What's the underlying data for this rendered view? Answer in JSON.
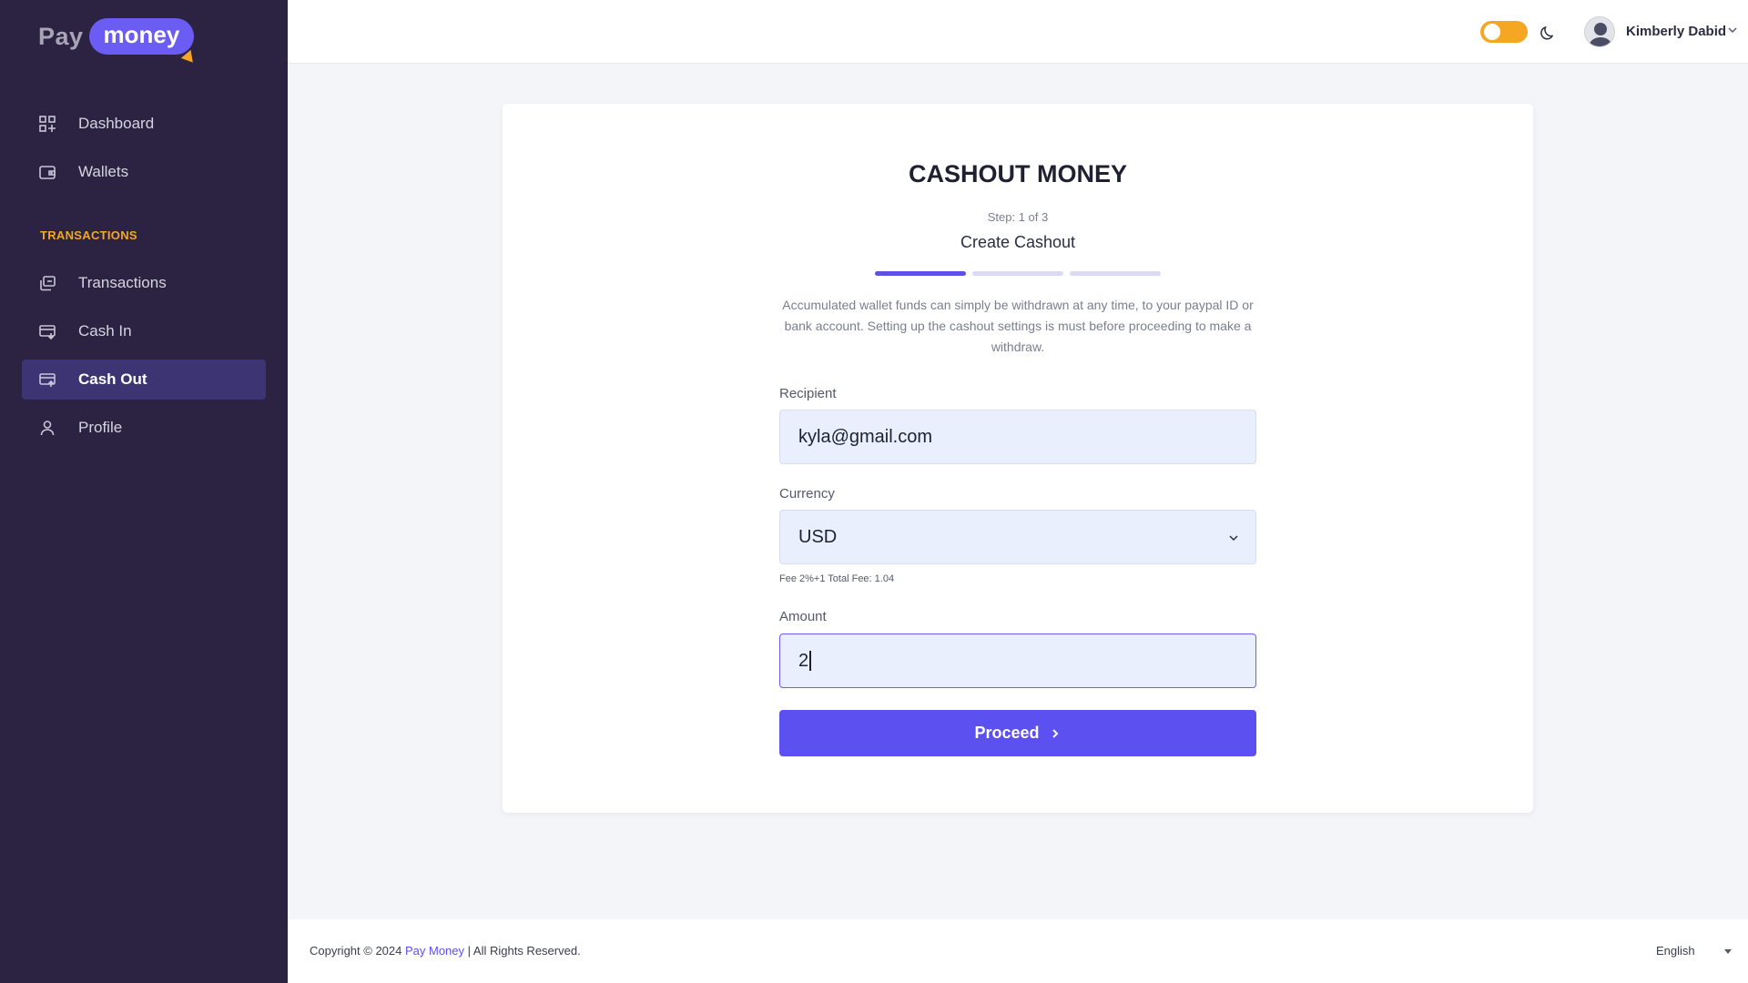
{
  "brand": {
    "pay": "Pay",
    "money": "money"
  },
  "sidebar": {
    "items": [
      {
        "label": "Dashboard",
        "icon": "dashboard-icon"
      },
      {
        "label": "Wallets",
        "icon": "wallet-icon"
      }
    ],
    "section_label": "TRANSACTIONS",
    "tx_items": [
      {
        "label": "Transactions",
        "icon": "transactions-icon"
      },
      {
        "label": "Cash In",
        "icon": "cash-in-icon"
      },
      {
        "label": "Cash Out",
        "icon": "cash-out-icon",
        "active": true
      },
      {
        "label": "Profile",
        "icon": "user-icon"
      }
    ]
  },
  "header": {
    "theme_toggle_on": true,
    "user_name": "Kimberly Dabid"
  },
  "form": {
    "title": "CASHOUT MONEY",
    "step": "Step: 1 of 3",
    "subtitle": "Create Cashout",
    "progress_steps": 3,
    "progress_current": 1,
    "description": "Accumulated wallet funds can simply be withdrawn at any time, to your paypal ID or bank account. Setting up the cashout settings is must before proceeding to make a withdraw.",
    "recipient_label": "Recipient",
    "recipient_value": "kyla@gmail.com",
    "currency_label": "Currency",
    "currency_value": "USD",
    "fee_text": "Fee 2%+1 Total Fee:  1.04",
    "amount_label": "Amount",
    "amount_value": "2",
    "proceed_label": "Proceed"
  },
  "footer": {
    "copyright_prefix": "Copyright © 2024 ",
    "brand_link": "Pay Money",
    "copyright_suffix": " | All Rights Reserved.",
    "language": "English"
  },
  "colors": {
    "sidebar_bg": "#2c2343",
    "accent": "#5d50f1",
    "toggle": "#f5a623",
    "section_label": "#f5a623"
  }
}
